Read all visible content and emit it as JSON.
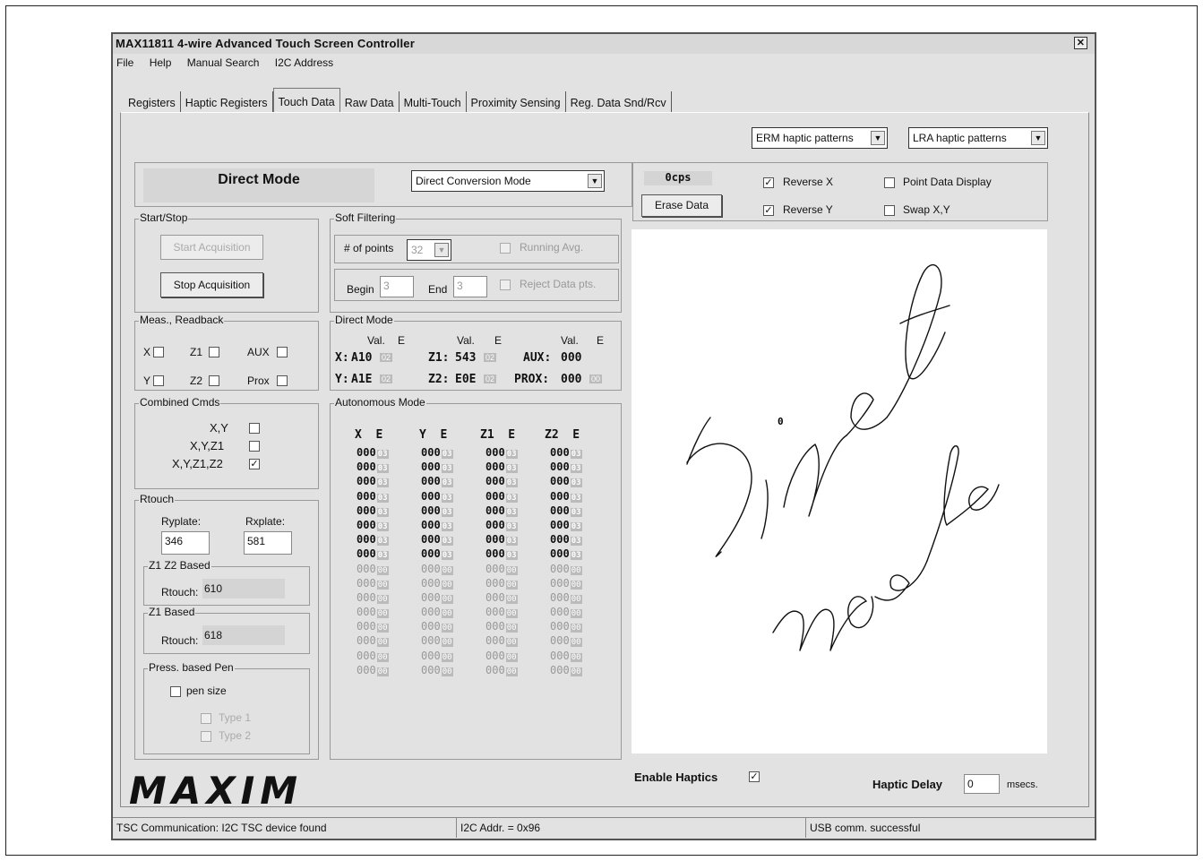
{
  "window": {
    "title": "MAX11811 4-wire Advanced Touch Screen Controller",
    "close_icon": "close-icon"
  },
  "menu": {
    "file": "File",
    "help": "Help",
    "manual_search": "Manual Search",
    "i2c_address": "I2C Address"
  },
  "tabs": [
    "Registers",
    "Haptic Registers",
    "Touch Data",
    "Raw Data",
    "Multi-Touch",
    "Proximity Sensing",
    "Reg. Data Snd/Rcv"
  ],
  "active_tab": "Touch Data",
  "haptics": {
    "erm": "ERM haptic patterns",
    "lra": "LRA haptic patterns"
  },
  "mode": {
    "title": "Direct Mode",
    "select": "Direct Conversion Mode"
  },
  "display": {
    "cps": "0cps",
    "erase": "Erase Data",
    "reverse_x": "Reverse X",
    "reverse_y": "Reverse Y",
    "point_data": "Point Data Display",
    "swap": "Swap X,Y",
    "reverse_x_checked": true,
    "reverse_y_checked": true
  },
  "start_stop": {
    "label": "Start/Stop",
    "start": "Start Acquisition",
    "stop": "Stop Acquisition"
  },
  "soft_filter": {
    "label": "Soft Filtering",
    "points_label": "# of points",
    "points": "32",
    "running": "Running Avg.",
    "begin_label": "Begin",
    "begin": "3",
    "end_label": "End",
    "end": "3",
    "reject": "Reject Data pts."
  },
  "meas": {
    "label": "Meas., Readback",
    "x": "X",
    "z1": "Z1",
    "aux": "AUX",
    "y": "Y",
    "z2": "Z2",
    "prox": "Prox"
  },
  "direct": {
    "label": "Direct Mode",
    "val": "Val.",
    "e": "E",
    "x_label": "X:",
    "x_val": "A10",
    "x_e": "02",
    "z1_label": "Z1:",
    "z1_val": "543",
    "z1_e": "02",
    "aux_label": "AUX:",
    "aux_val": "000",
    "y_label": "Y:",
    "y_val": "A1E",
    "y_e": "02",
    "z2_label": "Z2:",
    "z2_val": "E0E",
    "z2_e": "02",
    "prox_label": "PROX:",
    "prox_val": "000",
    "prox_e": "00"
  },
  "combined": {
    "label": "Combined Cmds",
    "xy": "X,Y",
    "xyz1": "X,Y,Z1",
    "xyz1z2": "X,Y,Z1,Z2",
    "xyz1z2_checked": true
  },
  "rtouch": {
    "label": "Rtouch",
    "ryplate": "Ryplate:",
    "rxplate": "Rxplate:",
    "ry": "346",
    "rx": "581",
    "z1z2_label": "Z1 Z2 Based",
    "z1z2_rtouch_label": "Rtouch:",
    "z1z2_rtouch": "610",
    "z1_label": "Z1 Based",
    "z1_rtouch_label": "Rtouch:",
    "z1_rtouch": "618"
  },
  "pen": {
    "label": "Press. based Pen",
    "size": "pen size",
    "type1": "Type 1",
    "type2": "Type 2"
  },
  "auto": {
    "label": "Autonomous Mode",
    "headers": [
      "X  E",
      "Y  E",
      "Z1  E",
      "Z2  E"
    ],
    "active_rows": 8,
    "total_rows": 16,
    "value": "000",
    "flag_active": "03",
    "flag_inactive": "00"
  },
  "canvas": {
    "marker": "0",
    "handwriting": "Direct mode"
  },
  "footer": {
    "logo": "MAXIM",
    "enable_haptics": "Enable Haptics",
    "enable_haptics_checked": true,
    "delay_label": "Haptic Delay",
    "delay": "0",
    "msecs": "msecs."
  },
  "status": {
    "tsc": "TSC Communication: I2C TSC device found",
    "addr": "I2C Addr. = 0x96",
    "usb": "USB comm. successful"
  }
}
